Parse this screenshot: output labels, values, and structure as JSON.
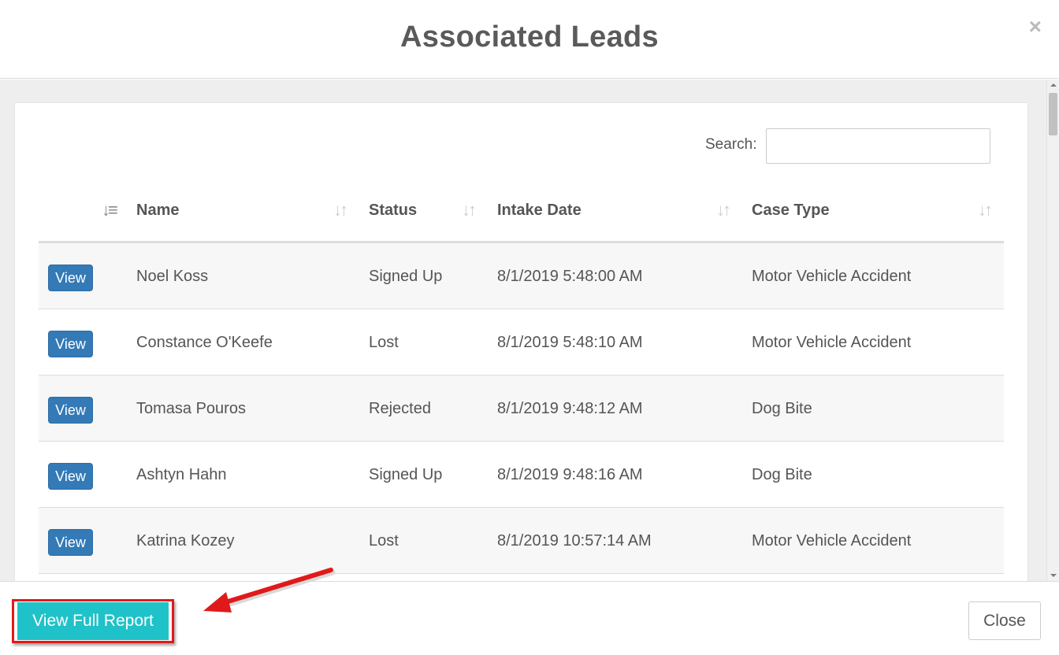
{
  "modal": {
    "title": "Associated Leads",
    "close_glyph": "×"
  },
  "search": {
    "label": "Search:",
    "value": "",
    "placeholder": ""
  },
  "table": {
    "columns": {
      "action": "",
      "name": "Name",
      "status": "Status",
      "intake_date": "Intake Date",
      "case_type": "Case Type"
    },
    "sort_icons": {
      "action": "sort-amount-asc-icon",
      "other": "sort-both-icon"
    },
    "rows": [
      {
        "action": "View",
        "name": "Noel Koss",
        "status": "Signed Up",
        "intake_date": "8/1/2019 5:48:00 AM",
        "case_type": "Motor Vehicle Accident"
      },
      {
        "action": "View",
        "name": "Constance O'Keefe",
        "status": "Lost",
        "intake_date": "8/1/2019 5:48:10 AM",
        "case_type": "Motor Vehicle Accident"
      },
      {
        "action": "View",
        "name": "Tomasa Pouros",
        "status": "Rejected",
        "intake_date": "8/1/2019 9:48:12 AM",
        "case_type": "Dog Bite"
      },
      {
        "action": "View",
        "name": "Ashtyn Hahn",
        "status": "Signed Up",
        "intake_date": "8/1/2019 9:48:16 AM",
        "case_type": "Dog Bite"
      },
      {
        "action": "View",
        "name": "Katrina Kozey",
        "status": "Lost",
        "intake_date": "8/1/2019 10:57:14 AM",
        "case_type": "Motor Vehicle Accident"
      }
    ]
  },
  "footer": {
    "report_label": "View Full Report",
    "close_label": "Close"
  },
  "colors": {
    "view_button": "#337ab7",
    "report_button": "#1fc2c8",
    "annotation": "#e01a1a"
  }
}
